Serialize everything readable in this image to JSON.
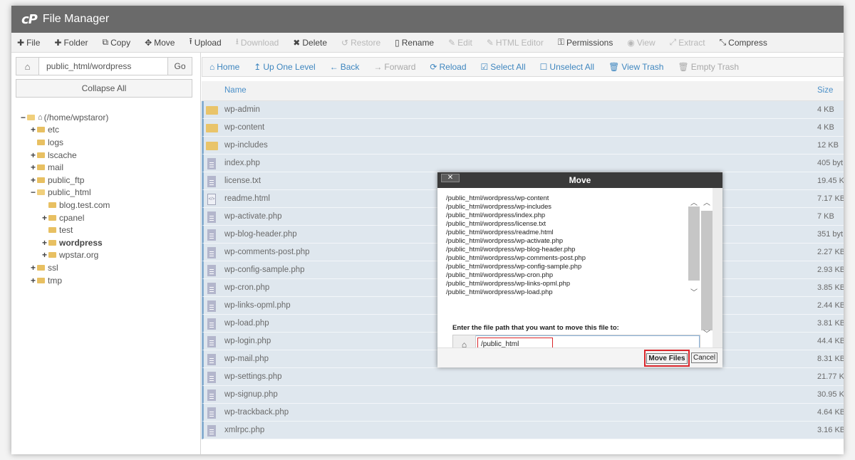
{
  "app": {
    "logo": "cP",
    "title": "File Manager"
  },
  "toolbar": [
    {
      "icon": "plus-icon",
      "glyph": "✚",
      "label": "File",
      "disabled": false
    },
    {
      "icon": "plus-icon",
      "glyph": "✚",
      "label": "Folder",
      "disabled": false
    },
    {
      "icon": "copy-icon",
      "glyph": "⧉",
      "label": "Copy",
      "disabled": false
    },
    {
      "icon": "move-icon",
      "glyph": "✥",
      "label": "Move",
      "disabled": false
    },
    {
      "icon": "upload-icon",
      "glyph": "⭱",
      "label": "Upload",
      "disabled": false
    },
    {
      "icon": "download-icon",
      "glyph": "⭳",
      "label": "Download",
      "disabled": true
    },
    {
      "icon": "delete-icon",
      "glyph": "✖",
      "label": "Delete",
      "disabled": false
    },
    {
      "icon": "restore-icon",
      "glyph": "↺",
      "label": "Restore",
      "disabled": true
    },
    {
      "icon": "rename-icon",
      "glyph": "▯",
      "label": "Rename",
      "disabled": false
    },
    {
      "icon": "edit-icon",
      "glyph": "✎",
      "label": "Edit",
      "disabled": true
    },
    {
      "icon": "html-editor-icon",
      "glyph": "✎",
      "label": "HTML Editor",
      "disabled": true
    },
    {
      "icon": "key-icon",
      "glyph": "⚿",
      "label": "Permissions",
      "disabled": false
    },
    {
      "icon": "eye-icon",
      "glyph": "◉",
      "label": "View",
      "disabled": true
    },
    {
      "icon": "extract-icon",
      "glyph": "⤢",
      "label": "Extract",
      "disabled": true
    },
    {
      "icon": "compress-icon",
      "glyph": "⤡",
      "label": "Compress",
      "disabled": false
    }
  ],
  "left": {
    "path_value": "public_html/wordpress",
    "go_label": "Go",
    "collapse_label": "Collapse All"
  },
  "tree": [
    {
      "depth": 0,
      "toggle": "−",
      "home": true,
      "open": true,
      "label": "(/home/wpstaror)",
      "bold": false
    },
    {
      "depth": 1,
      "toggle": "+",
      "open": false,
      "label": "etc",
      "bold": false
    },
    {
      "depth": 1,
      "toggle": "",
      "open": false,
      "label": "logs",
      "bold": false
    },
    {
      "depth": 1,
      "toggle": "+",
      "open": false,
      "label": "lscache",
      "bold": false
    },
    {
      "depth": 1,
      "toggle": "+",
      "open": false,
      "label": "mail",
      "bold": false
    },
    {
      "depth": 1,
      "toggle": "+",
      "open": false,
      "label": "public_ftp",
      "bold": false
    },
    {
      "depth": 1,
      "toggle": "−",
      "open": true,
      "label": "public_html",
      "bold": false
    },
    {
      "depth": 2,
      "toggle": "",
      "open": false,
      "label": "blog.test.com",
      "bold": false
    },
    {
      "depth": 2,
      "toggle": "+",
      "open": false,
      "label": "cpanel",
      "bold": false
    },
    {
      "depth": 2,
      "toggle": "",
      "open": false,
      "label": "test",
      "bold": false
    },
    {
      "depth": 2,
      "toggle": "+",
      "open": false,
      "label": "wordpress",
      "bold": true
    },
    {
      "depth": 2,
      "toggle": "+",
      "open": false,
      "label": "wpstar.org",
      "bold": false
    },
    {
      "depth": 1,
      "toggle": "+",
      "open": false,
      "label": "ssl",
      "bold": false
    },
    {
      "depth": 1,
      "toggle": "+",
      "open": false,
      "label": "tmp",
      "bold": false
    }
  ],
  "navbar": [
    {
      "icon": "home-icon",
      "glyph": "⌂",
      "label": "Home",
      "disabled": false
    },
    {
      "icon": "arrow-up-icon",
      "glyph": "↥",
      "label": "Up One Level",
      "disabled": false
    },
    {
      "icon": "arrow-left-icon",
      "glyph": "←",
      "label": "Back",
      "disabled": false
    },
    {
      "icon": "arrow-right-icon",
      "glyph": "→",
      "label": "Forward",
      "disabled": true
    },
    {
      "icon": "reload-icon",
      "glyph": "⟳",
      "label": "Reload",
      "disabled": false
    },
    {
      "icon": "check-square-icon",
      "glyph": "☑",
      "label": "Select All",
      "disabled": false
    },
    {
      "icon": "square-icon",
      "glyph": "☐",
      "label": "Unselect All",
      "disabled": false
    },
    {
      "icon": "trash-icon",
      "glyph": "🗑",
      "label": "View Trash",
      "disabled": false
    },
    {
      "icon": "trash-icon",
      "glyph": "🗑",
      "label": "Empty Trash",
      "disabled": true
    }
  ],
  "list": {
    "col_name": "Name",
    "col_size": "Size",
    "rows": [
      {
        "type": "folder",
        "name": "wp-admin",
        "size": "4 KB"
      },
      {
        "type": "folder",
        "name": "wp-content",
        "size": "4 KB"
      },
      {
        "type": "folder",
        "name": "wp-includes",
        "size": "12 KB"
      },
      {
        "type": "file",
        "name": "index.php",
        "size": "405 byt"
      },
      {
        "type": "file",
        "name": "license.txt",
        "size": "19.45 K"
      },
      {
        "type": "html",
        "name": "readme.html",
        "size": "7.17 KB"
      },
      {
        "type": "file",
        "name": "wp-activate.php",
        "size": "7 KB"
      },
      {
        "type": "file",
        "name": "wp-blog-header.php",
        "size": "351 byt"
      },
      {
        "type": "file",
        "name": "wp-comments-post.php",
        "size": "2.27 KB"
      },
      {
        "type": "file",
        "name": "wp-config-sample.php",
        "size": "2.93 KB"
      },
      {
        "type": "file",
        "name": "wp-cron.php",
        "size": "3.85 KB"
      },
      {
        "type": "file",
        "name": "wp-links-opml.php",
        "size": "2.44 KB"
      },
      {
        "type": "file",
        "name": "wp-load.php",
        "size": "3.81 KB"
      },
      {
        "type": "file",
        "name": "wp-login.php",
        "size": "44.4 KB"
      },
      {
        "type": "file",
        "name": "wp-mail.php",
        "size": "8.31 KB"
      },
      {
        "type": "file",
        "name": "wp-settings.php",
        "size": "21.77 K"
      },
      {
        "type": "file",
        "name": "wp-signup.php",
        "size": "30.95 K"
      },
      {
        "type": "file",
        "name": "wp-trackback.php",
        "size": "4.64 KB"
      },
      {
        "type": "file",
        "name": "xmlrpc.php",
        "size": "3.16 KB"
      }
    ]
  },
  "modal": {
    "title": "Move",
    "close_label": "✕",
    "files": [
      "/public_html/wordpress/wp-content",
      "/public_html/wordpress/wp-includes",
      "/public_html/wordpress/index.php",
      "/public_html/wordpress/license.txt",
      "/public_html/wordpress/readme.html",
      "/public_html/wordpress/wp-activate.php",
      "/public_html/wordpress/wp-blog-header.php",
      "/public_html/wordpress/wp-comments-post.php",
      "/public_html/wordpress/wp-config-sample.php",
      "/public_html/wordpress/wp-cron.php",
      "/public_html/wordpress/wp-links-opml.php",
      "/public_html/wordpress/wp-load.php"
    ],
    "prompt": "Enter the file path that you want to move this file to:",
    "dest_value": "/public_html",
    "move_label": "Move Files",
    "cancel_label": "Cancel"
  }
}
